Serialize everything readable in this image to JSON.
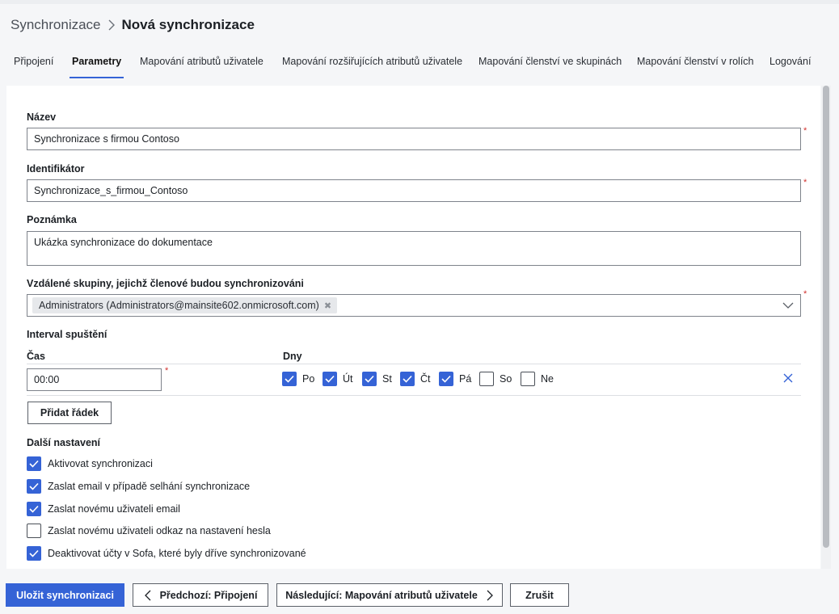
{
  "breadcrumb": {
    "parent": "Synchronizace",
    "current": "Nová synchronizace"
  },
  "tabs": [
    {
      "label": "Připojení"
    },
    {
      "label": "Parametry",
      "active": true
    },
    {
      "label": "Mapování atributů uživatele"
    },
    {
      "label": "Mapování rozšiřujících atributů uživatele"
    },
    {
      "label": "Mapování členství ve skupinách"
    },
    {
      "label": "Mapování členství v rolích"
    },
    {
      "label": "Logování"
    }
  ],
  "form": {
    "name": {
      "label": "Název",
      "value": "Synchronizace s firmou Contoso"
    },
    "identifier": {
      "label": "Identifikátor",
      "value": "Synchronizace_s_firmou_Contoso"
    },
    "note": {
      "label": "Poznámka",
      "value": "Ukázka synchronizace do dokumentace"
    },
    "groups": {
      "label": "Vzdálené skupiny, jejichž členové budou synchronizováni",
      "chip": "Administrators (Administrators@mainsite602.onmicrosoft.com)"
    },
    "required_mark": "*"
  },
  "schedule": {
    "title": "Interval spuštění",
    "time_header": "Čas",
    "days_header": "Dny",
    "time_value": "00:00",
    "days": [
      {
        "label": "Po",
        "checked": true
      },
      {
        "label": "Út",
        "checked": true
      },
      {
        "label": "St",
        "checked": true
      },
      {
        "label": "Čt",
        "checked": true
      },
      {
        "label": "Pá",
        "checked": true
      },
      {
        "label": "So",
        "checked": false
      },
      {
        "label": "Ne",
        "checked": false
      }
    ],
    "add_row": "Přidat řádek"
  },
  "other": {
    "title": "Další nastavení",
    "options": [
      {
        "label": "Aktivovat synchronizaci",
        "checked": true
      },
      {
        "label": "Zaslat email v případě selhání synchronizace",
        "checked": true
      },
      {
        "label": "Zaslat novému uživateli email",
        "checked": true
      },
      {
        "label": "Zaslat novému uživateli odkaz na nastavení hesla",
        "checked": false
      },
      {
        "label": "Deaktivovat účty v Sofa, které byly dříve synchronizované",
        "checked": true
      }
    ]
  },
  "footer": {
    "save": "Uložit synchronizaci",
    "prev": "Předchozí: Připojení",
    "next": "Následující: Mapování atributů uživatele",
    "cancel": "Zrušit"
  },
  "colors": {
    "accent": "#3563d6",
    "required": "#d1322f",
    "border": "#7e838b"
  },
  "icons": [
    "chevron-right-icon",
    "chevron-down-icon",
    "chip-remove-icon",
    "close-icon",
    "check-icon",
    "chevron-left-icon"
  ]
}
